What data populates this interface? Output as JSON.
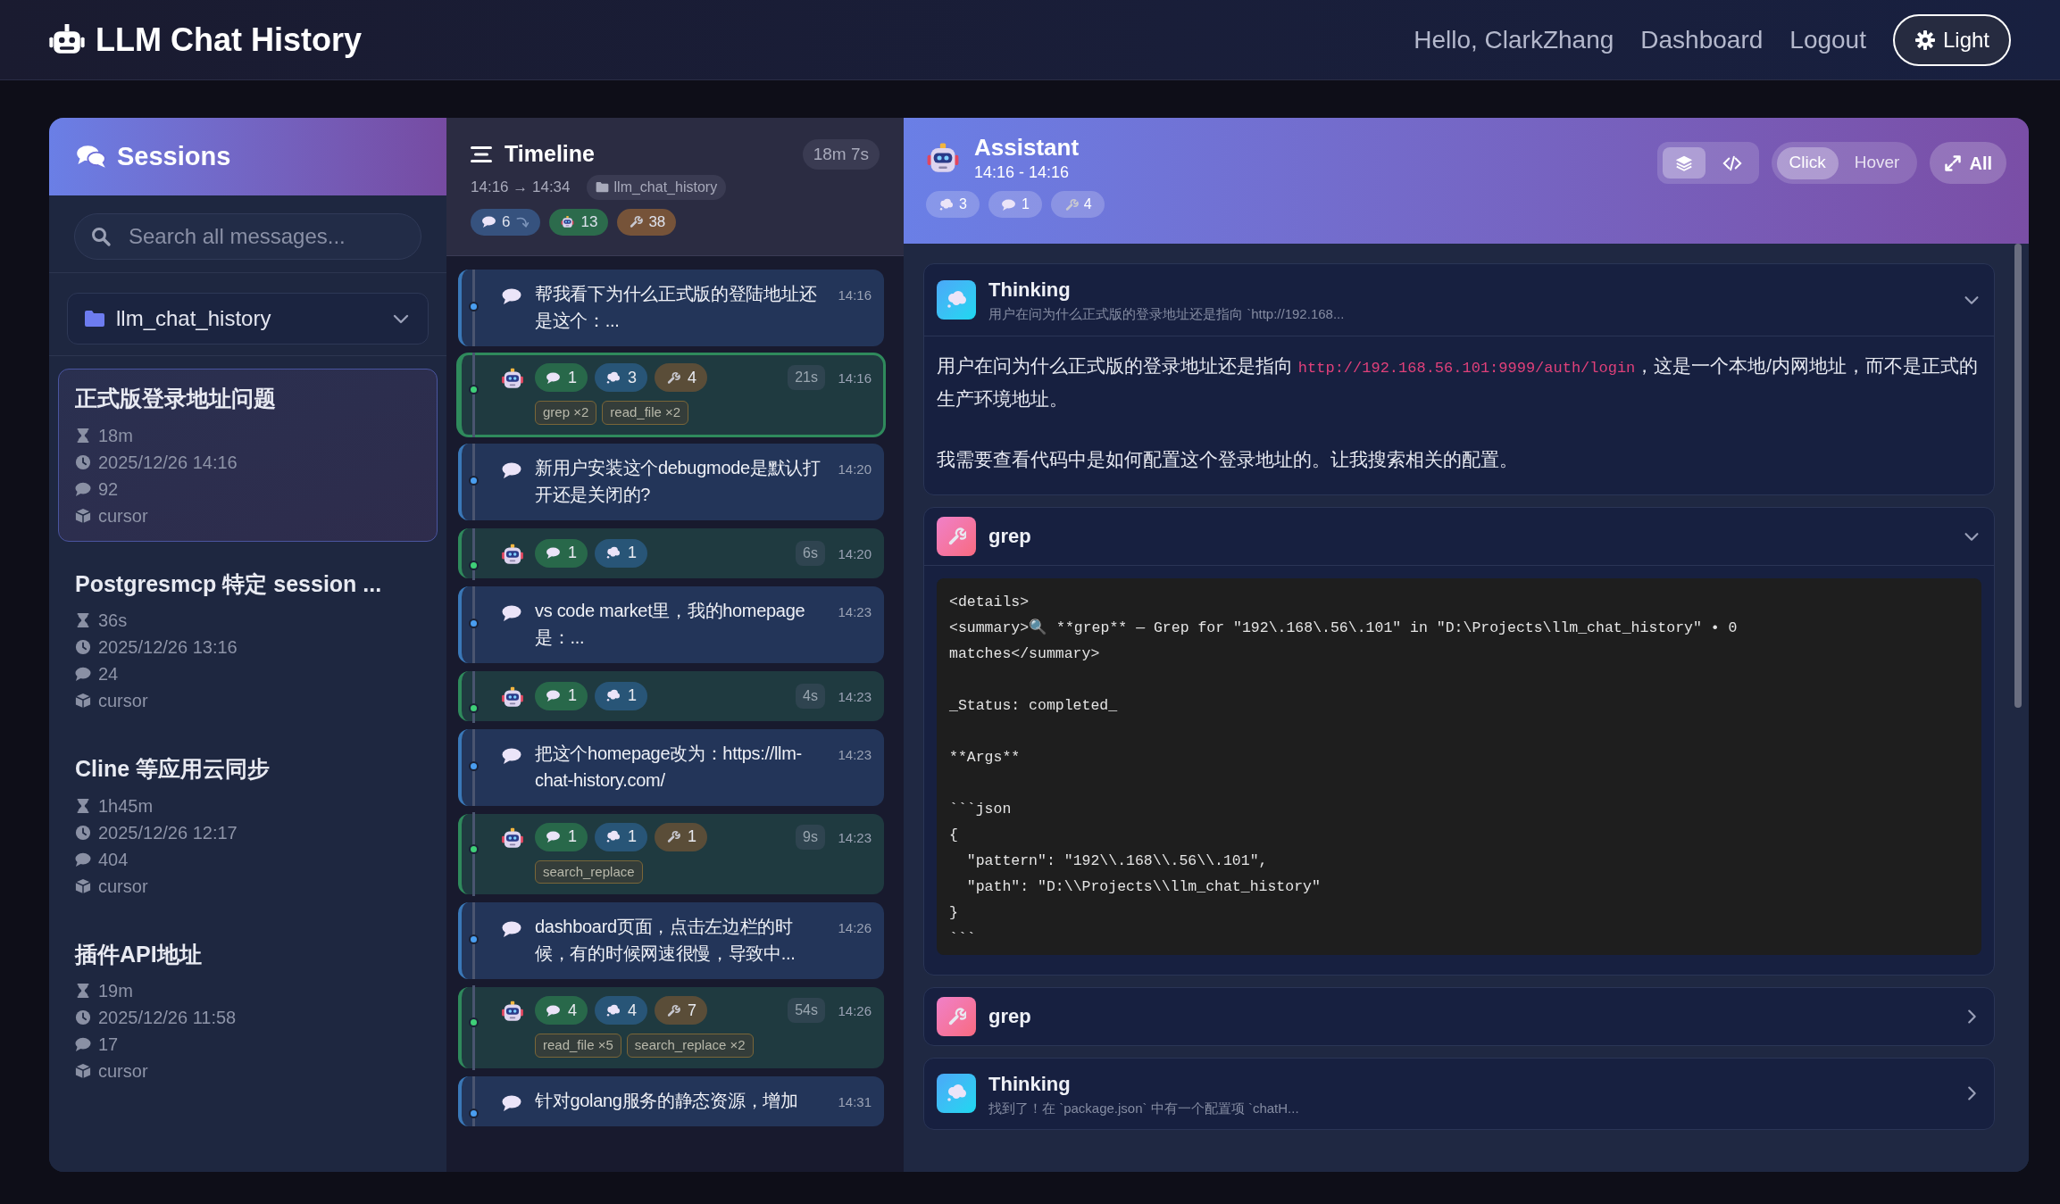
{
  "header": {
    "title": "LLM Chat History",
    "greeting": "Hello, ClarkZhang",
    "nav": [
      {
        "label": "Dashboard"
      },
      {
        "label": "Logout"
      }
    ],
    "theme_button": "Light"
  },
  "sessions": {
    "title": "Sessions",
    "search": {
      "placeholder": "Search all messages..."
    },
    "project": "llm_chat_history",
    "items": [
      {
        "title": "正式版登录地址问题",
        "duration": "18m",
        "date": "2025/12/26 14:16",
        "messages": "92",
        "source": "cursor",
        "selected": true
      },
      {
        "title": "Postgresmcp 特定 session ...",
        "duration": "36s",
        "date": "2025/12/26 13:16",
        "messages": "24",
        "source": "cursor",
        "selected": false
      },
      {
        "title": "Cline 等应用云同步",
        "duration": "1h45m",
        "date": "2025/12/26 12:17",
        "messages": "404",
        "source": "cursor",
        "selected": false
      },
      {
        "title": "插件API地址",
        "duration": "19m",
        "date": "2025/12/26 11:58",
        "messages": "17",
        "source": "cursor",
        "selected": false
      }
    ]
  },
  "timeline": {
    "title": "Timeline",
    "total": "18m 7s",
    "range": "14:16 → 14:34",
    "project": "llm_chat_history",
    "stats": [
      {
        "kind": "message",
        "count": "6"
      },
      {
        "kind": "assistant",
        "count": "13"
      },
      {
        "kind": "tool",
        "count": "38"
      }
    ],
    "items": [
      {
        "kind": "user",
        "text": "帮我看下为什么正式版的登陆地址还是这个：...",
        "time": "14:16",
        "selected": false
      },
      {
        "kind": "assistant",
        "counts": [
          {
            "kind": "message",
            "count": "1"
          },
          {
            "kind": "thinking",
            "count": "3"
          },
          {
            "kind": "tool",
            "count": "4"
          }
        ],
        "duration": "21s",
        "time": "14:16",
        "tags": [
          "grep ×2",
          "read_file ×2"
        ],
        "selected": true
      },
      {
        "kind": "user",
        "text": "新用户安装这个debugmode是默认打开还是关闭的?",
        "time": "14:20",
        "selected": false
      },
      {
        "kind": "assistant",
        "counts": [
          {
            "kind": "message",
            "count": "1"
          },
          {
            "kind": "thinking",
            "count": "1"
          }
        ],
        "duration": "6s",
        "time": "14:20",
        "selected": false
      },
      {
        "kind": "user",
        "text": "vs code market里，我的homepage是：...",
        "time": "14:23",
        "selected": false
      },
      {
        "kind": "assistant",
        "counts": [
          {
            "kind": "message",
            "count": "1"
          },
          {
            "kind": "thinking",
            "count": "1"
          }
        ],
        "duration": "4s",
        "time": "14:23",
        "selected": false
      },
      {
        "kind": "user",
        "text": "把这个homepage改为：https://llm-chat-history.com/",
        "time": "14:23",
        "selected": false
      },
      {
        "kind": "assistant",
        "counts": [
          {
            "kind": "message",
            "count": "1"
          },
          {
            "kind": "thinking",
            "count": "1"
          },
          {
            "kind": "tool",
            "count": "1"
          }
        ],
        "duration": "9s",
        "time": "14:23",
        "tags": [
          "search_replace"
        ],
        "selected": false
      },
      {
        "kind": "user",
        "text": "dashboard页面，点击左边栏的时候，有的时候网速很慢，导致中...",
        "time": "14:26",
        "selected": false
      },
      {
        "kind": "assistant",
        "counts": [
          {
            "kind": "message",
            "count": "4"
          },
          {
            "kind": "thinking",
            "count": "4"
          },
          {
            "kind": "tool",
            "count": "7"
          }
        ],
        "duration": "54s",
        "time": "14:26",
        "tags": [
          "read_file ×5",
          "search_replace ×2"
        ],
        "selected": false
      },
      {
        "kind": "user",
        "text": "针对golang服务的静态资源，增加",
        "time": "14:31",
        "selected": false
      }
    ]
  },
  "detail": {
    "role": "Assistant",
    "range": "14:16 - 14:16",
    "stats": [
      {
        "kind": "thinking",
        "count": "3"
      },
      {
        "kind": "message",
        "count": "1"
      },
      {
        "kind": "tool",
        "count": "4"
      }
    ],
    "view_modes": [
      {
        "kind": "layers",
        "selected": true
      },
      {
        "kind": "code",
        "selected": false
      }
    ],
    "triggers": [
      {
        "label": "Click",
        "selected": true
      },
      {
        "label": "Hover",
        "selected": false
      }
    ],
    "expand_all": "All",
    "blocks": [
      {
        "kind": "thinking",
        "title": "Thinking",
        "preview": "用户在问为什么正式版的登录地址还是指向 `http://192.168...",
        "expanded": true,
        "paragraphs": [
          [
            {
              "kind": "text",
              "text": "用户在问为什么正式版的登录地址还是指向 "
            },
            {
              "kind": "code",
              "text": "http://192.168.56.101:9999/auth/login"
            },
            {
              "kind": "text",
              "text": "，这是一个本地/内网地址，而不是正式的生产环境地址。"
            }
          ],
          [
            {
              "kind": "text",
              "text": "我需要查看代码中是如何配置这个登录地址的。让我搜索相关的配置。"
            }
          ]
        ]
      },
      {
        "kind": "tool",
        "title": "grep",
        "expanded": true,
        "code": "<details>\n<summary>🔍 **grep** — Grep for \"192\\.168\\.56\\.101\" in \"D:\\Projects\\llm_chat_history\" • 0 matches</summary>\n\n_Status: completed_\n\n**Args**\n\n```json\n{\n  \"pattern\": \"192\\\\.168\\\\.56\\\\.101\",\n  \"path\": \"D:\\\\Projects\\\\llm_chat_history\"\n}\n```"
      },
      {
        "kind": "tool",
        "title": "grep",
        "expanded": false
      },
      {
        "kind": "thinking",
        "title": "Thinking",
        "preview": "找到了！在 `package.json` 中有一个配置项 `chatH...",
        "expanded": false
      }
    ]
  }
}
